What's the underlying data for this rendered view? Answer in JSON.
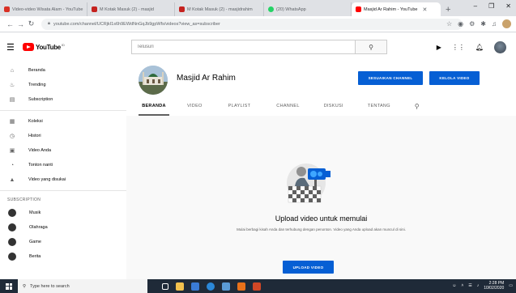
{
  "browser": {
    "tabs": [
      {
        "label": "Video-video Wisata Alam - YouTube",
        "favicon_color": "#d93025"
      },
      {
        "label": "M Kotak Masuk (2) - masjid",
        "favicon_color": "#c5221f"
      },
      {
        "label": "M Kotak Masuk (2) - masjidrahim",
        "favicon_color": "#c5221f"
      },
      {
        "label": "(20) WhatsApp",
        "favicon_color": "#25d366"
      },
      {
        "label": "Masjid Ar Rahim - YouTube",
        "favicon_color": "#ff0000",
        "active": true
      }
    ],
    "new_tab": "+",
    "window_controls": [
      "–",
      "❐",
      "✕"
    ],
    "url": "youtube.com/channel/UCRjkI1s6h9EWdNnGqJb9gpWfs/videos?view_as=subscriber"
  },
  "header": {
    "logo_text": "YouTube",
    "logo_sup": "ID",
    "search_placeholder": "Telusuri"
  },
  "sidebar": {
    "main_items": [
      {
        "icon": "home-icon",
        "glyph": "⌂",
        "label": "Beranda"
      },
      {
        "icon": "flame-icon",
        "glyph": "♨",
        "label": "Trending"
      },
      {
        "icon": "subscriptions-icon",
        "glyph": "▤",
        "label": "Subscription"
      }
    ],
    "library_items": [
      {
        "icon": "library-icon",
        "glyph": "▦",
        "label": "Koleksi"
      },
      {
        "icon": "history-icon",
        "glyph": "◷",
        "label": "Histori"
      },
      {
        "icon": "my-videos-icon",
        "glyph": "▣",
        "label": "Video Anda"
      },
      {
        "icon": "watch-later-icon",
        "glyph": "◔",
        "label": "Tonton nanti"
      },
      {
        "icon": "liked-icon",
        "glyph": "▲",
        "label": "Video yang disukai"
      }
    ],
    "subscriptions_heading": "SUBSCRIPTION",
    "subscriptions": [
      {
        "label": "Musik",
        "color": "#222222"
      },
      {
        "label": "Olahraga",
        "color": "#2c2c2c"
      },
      {
        "label": "Game",
        "color": "#262626"
      },
      {
        "label": "Berita",
        "color": "#303030"
      }
    ]
  },
  "channel": {
    "name": "Masjid Ar Rahim",
    "customize_button": "SESUAIKAN CHANNEL",
    "manage_button": "KELOLA VIDEO",
    "tabs": [
      "BERANDA",
      "VIDEO",
      "PLAYLIST",
      "CHANNEL",
      "DISKUSI",
      "TENTANG"
    ],
    "active_tab": 0
  },
  "empty_state": {
    "title": "Upload video untuk memulai",
    "description": "Mulai berbagi kisah Anda dan terhubung dengan penonton. Video yang Anda upload akan muncul di sini.",
    "upload_button": "UPLOAD VIDEO"
  },
  "taskbar": {
    "search_placeholder": "Type here to search",
    "time": "2:28 PM",
    "date": "10/02/2020",
    "apps": [
      {
        "name": "task-view",
        "color": "#ffffff"
      },
      {
        "name": "file-explorer",
        "color": "#f2c14e"
      },
      {
        "name": "store",
        "color": "#3a7bd5"
      },
      {
        "name": "edge",
        "color": "#2b88d8"
      },
      {
        "name": "mail",
        "color": "#5b9bd5"
      },
      {
        "name": "office",
        "color": "#e8711a"
      },
      {
        "name": "powerpoint",
        "color": "#d24726"
      }
    ]
  },
  "colors": {
    "accent_blue": "#065fd4",
    "youtube_red": "#ff0000"
  }
}
